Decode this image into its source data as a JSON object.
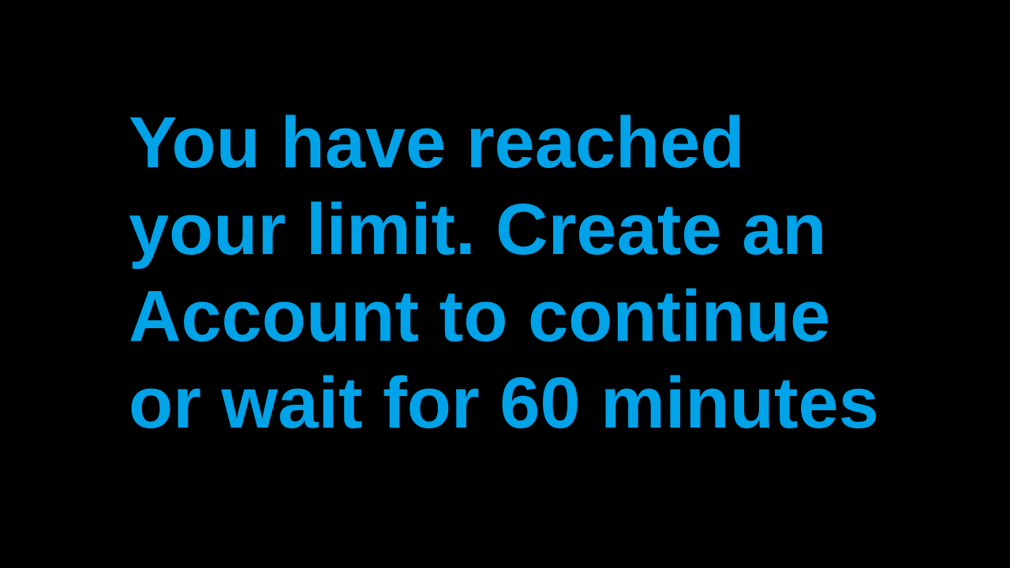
{
  "colors": {
    "background": "#000000",
    "text": "#00a2e8"
  },
  "message": {
    "lines": [
      "You have reached",
      "your limit. Create an",
      "Account to continue",
      "or wait for 60 minutes"
    ]
  }
}
